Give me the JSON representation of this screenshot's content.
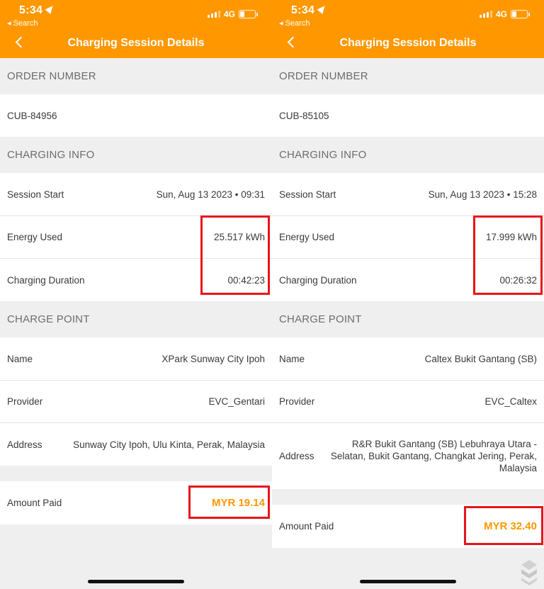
{
  "left": {
    "status": {
      "time": "5:34",
      "back_app": "◂ Search",
      "network": "4G",
      "battery": "27"
    },
    "nav": {
      "title": "Charging Session Details"
    },
    "order": {
      "header": "ORDER NUMBER",
      "number": "CUB-84956"
    },
    "charging": {
      "header": "CHARGING INFO",
      "session_start_label": "Session Start",
      "session_start_value": "Sun, Aug 13 2023 • 09:31",
      "energy_label": "Energy Used",
      "energy_value": "25.517 kWh",
      "duration_label": "Charging Duration",
      "duration_value": "00:42:23"
    },
    "charge_point": {
      "header": "CHARGE POINT",
      "name_label": "Name",
      "name_value": "XPark Sunway City Ipoh",
      "provider_label": "Provider",
      "provider_value": "EVC_Gentari",
      "address_label": "Address",
      "address_value": "Sunway City Ipoh, Ulu Kinta, Perak, Malaysia"
    },
    "payment": {
      "label": "Amount Paid",
      "value": "MYR 19.14"
    }
  },
  "right": {
    "status": {
      "time": "5:34",
      "back_app": "◂ Search",
      "network": "4G",
      "battery": "27"
    },
    "nav": {
      "title": "Charging Session Details"
    },
    "order": {
      "header": "ORDER NUMBER",
      "number": "CUB-85105"
    },
    "charging": {
      "header": "CHARGING INFO",
      "session_start_label": "Session Start",
      "session_start_value": "Sun, Aug 13 2023 • 15:28",
      "energy_label": "Energy Used",
      "energy_value": "17.999 kWh",
      "duration_label": "Charging Duration",
      "duration_value": "00:26:32"
    },
    "charge_point": {
      "header": "CHARGE POINT",
      "name_label": "Name",
      "name_value": "Caltex Bukit Gantang (SB)",
      "provider_label": "Provider",
      "provider_value": "EVC_Caltex",
      "address_label": "Address",
      "address_lines": [
        "R&R Bukit Gantang (SB) Lebuhraya Utara -",
        "Selatan, Bukit Gantang, Changkat Jering, Perak,",
        "Malaysia"
      ]
    },
    "payment": {
      "label": "Amount Paid",
      "value": "MYR 32.40"
    }
  },
  "icons": {
    "back": "chevron-left-icon",
    "location": "location-arrow-icon",
    "signal": "cellular-signal-icon",
    "battery": "battery-icon",
    "watermark": "watermark-logo-icon"
  },
  "colors": {
    "accent": "#ff9800",
    "highlight_box": "#e8141c",
    "background": "#efefef"
  }
}
